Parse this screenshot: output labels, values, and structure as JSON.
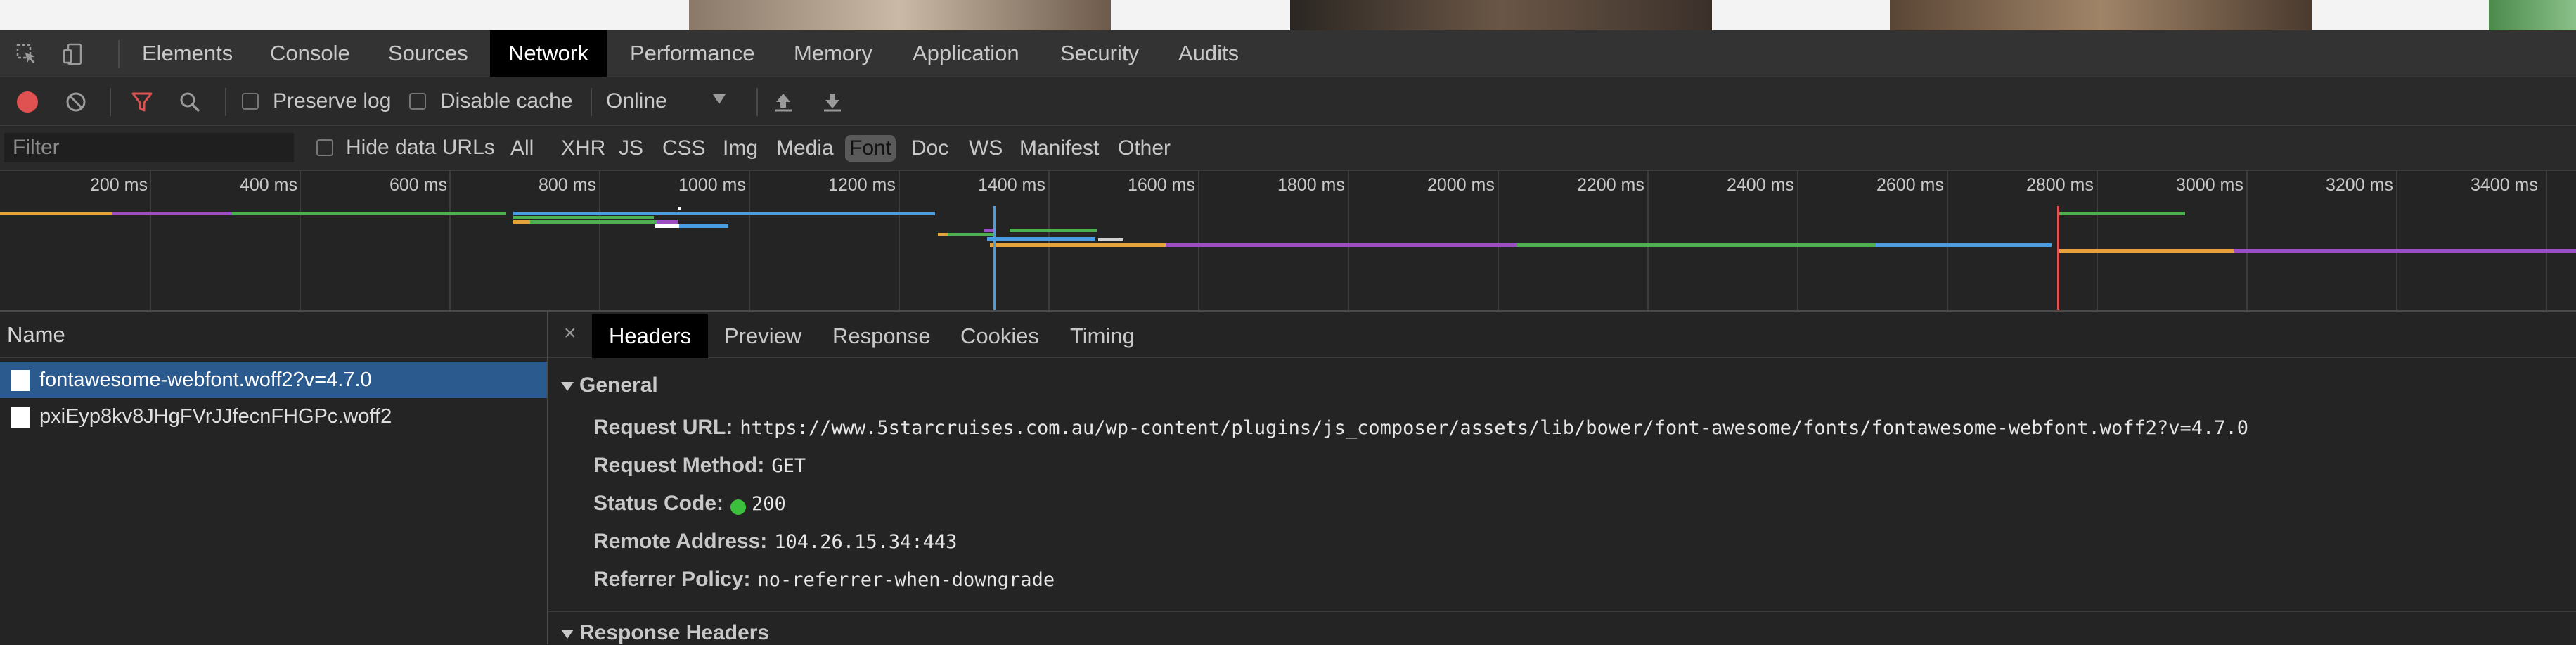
{
  "devtools_tabs": [
    {
      "label": "Elements",
      "active": false
    },
    {
      "label": "Console",
      "active": false
    },
    {
      "label": "Sources",
      "active": false
    },
    {
      "label": "Network",
      "active": true
    },
    {
      "label": "Performance",
      "active": false
    },
    {
      "label": "Memory",
      "active": false
    },
    {
      "label": "Application",
      "active": false
    },
    {
      "label": "Security",
      "active": false
    },
    {
      "label": "Audits",
      "active": false
    }
  ],
  "toolbar": {
    "preserve_log_label": "Preserve log",
    "disable_cache_label": "Disable cache",
    "throttle_value": "Online"
  },
  "filterbar": {
    "filter_placeholder": "Filter",
    "hide_data_urls_label": "Hide data URLs",
    "types": [
      {
        "label": "All",
        "active": false
      },
      {
        "label": "XHR",
        "active": false
      },
      {
        "label": "JS",
        "active": false
      },
      {
        "label": "CSS",
        "active": false
      },
      {
        "label": "Img",
        "active": false
      },
      {
        "label": "Media",
        "active": false
      },
      {
        "label": "Font",
        "active": true
      },
      {
        "label": "Doc",
        "active": false
      },
      {
        "label": "WS",
        "active": false
      },
      {
        "label": "Manifest",
        "active": false
      },
      {
        "label": "Other",
        "active": false
      }
    ]
  },
  "timeline": {
    "ticks": [
      "200 ms",
      "400 ms",
      "600 ms",
      "800 ms",
      "1000 ms",
      "1200 ms",
      "1400 ms",
      "1600 ms",
      "1800 ms",
      "2000 ms",
      "2200 ms",
      "2400 ms",
      "2600 ms",
      "2800 ms",
      "3000 ms",
      "3200 ms",
      "3400 ms"
    ],
    "colors": {
      "orange": "#e8a23a",
      "purple": "#9b4fc4",
      "green": "#4caf50",
      "blue": "#4a9de0",
      "red_marker": "#e05252",
      "blue_marker": "#4a9de0"
    }
  },
  "requests": {
    "header": "Name",
    "rows": [
      {
        "name": "fontawesome-webfont.woff2?v=4.7.0",
        "selected": true
      },
      {
        "name": "pxiEyp8kv8JHgFVrJJfecnFHGPc.woff2",
        "selected": false
      }
    ]
  },
  "details": {
    "close": "×",
    "tabs": [
      {
        "label": "Headers",
        "active": true
      },
      {
        "label": "Preview",
        "active": false
      },
      {
        "label": "Response",
        "active": false
      },
      {
        "label": "Cookies",
        "active": false
      },
      {
        "label": "Timing",
        "active": false
      }
    ],
    "general_title": "General",
    "general": [
      {
        "key": "Request URL:",
        "value": "https://www.5starcruises.com.au/wp-content/plugins/js_composer/assets/lib/bower/font-awesome/fonts/fontawesome-webfont.woff2?v=4.7.0"
      },
      {
        "key": "Request Method:",
        "value": "GET"
      },
      {
        "key": "Status Code:",
        "value": "200"
      },
      {
        "key": "Remote Address:",
        "value": "104.26.15.34:443"
      },
      {
        "key": "Referrer Policy:",
        "value": "no-referrer-when-downgrade"
      }
    ],
    "response_headers_title": "Response Headers"
  }
}
